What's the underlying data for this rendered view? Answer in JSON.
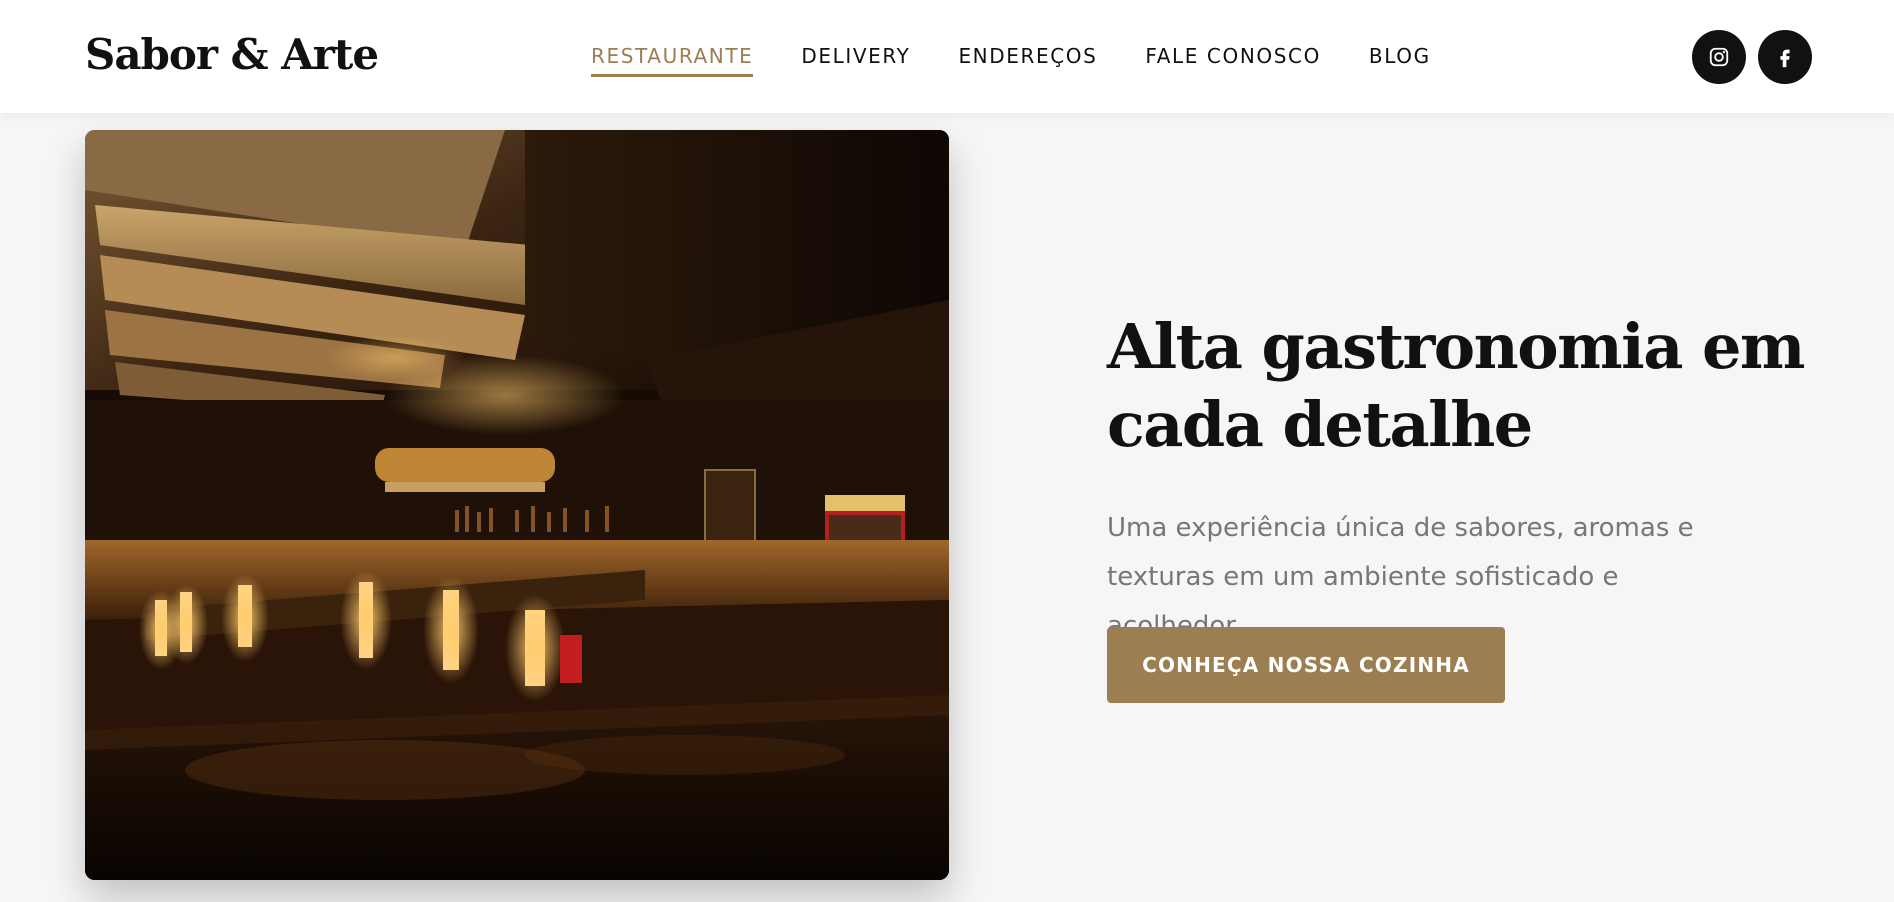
{
  "header": {
    "logo": "Sabor & Arte",
    "nav": [
      {
        "label": "RESTAURANTE",
        "active": true
      },
      {
        "label": "DELIVERY",
        "active": false
      },
      {
        "label": "ENDEREÇOS",
        "active": false
      },
      {
        "label": "FALE CONOSCO",
        "active": false
      },
      {
        "label": "BLOG",
        "active": false
      }
    ],
    "social": [
      {
        "icon": "instagram-icon"
      },
      {
        "icon": "facebook-icon"
      }
    ]
  },
  "hero": {
    "image_icon": "restaurant-interior-photo",
    "title": "Alta gastronomia em cada detalhe",
    "subtitle": "Uma experiência única de sabores, aromas e texturas em um ambiente sofisticado e acolhedor.",
    "cta_label": "CONHEÇA NOSSA COZINHA"
  },
  "colors": {
    "accent": "#9b7e52",
    "background": "#f6f6f6",
    "header_bg": "#ffffff",
    "text": "#111111",
    "muted": "#777777"
  }
}
